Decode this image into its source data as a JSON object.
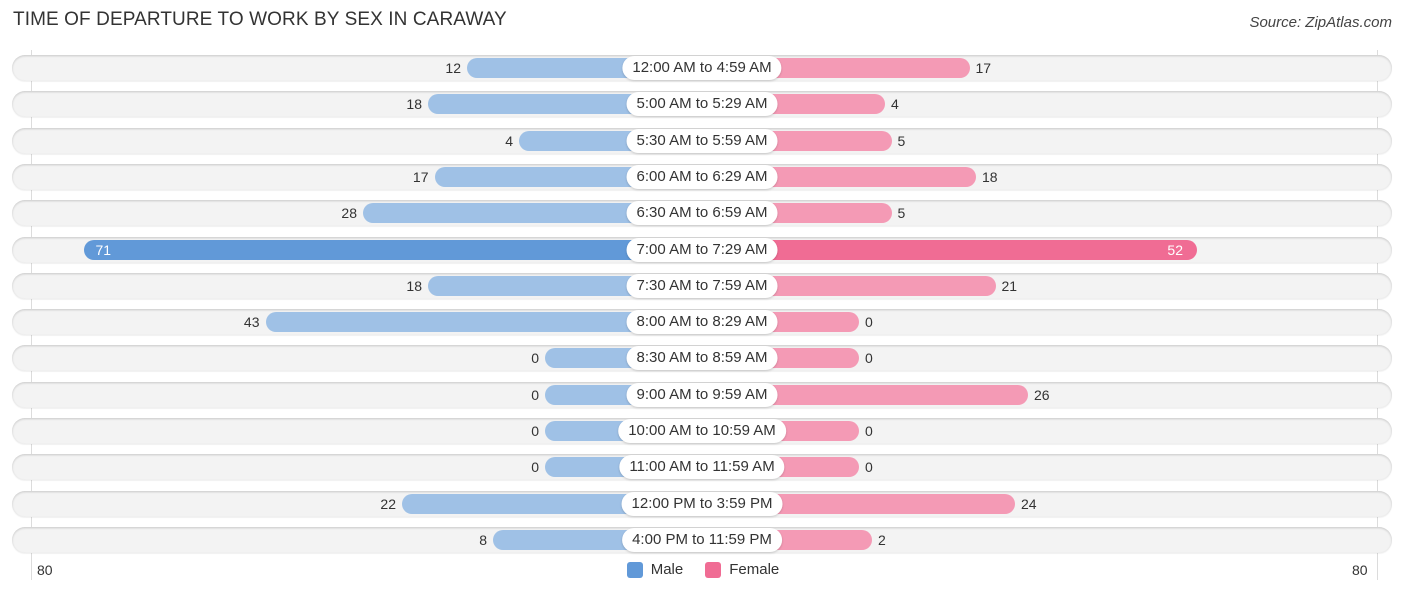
{
  "header": {
    "title": "TIME OF DEPARTURE TO WORK BY SEX IN CARAWAY",
    "source": "Source: ZipAtlas.com"
  },
  "colors": {
    "male": "#9fc1e6",
    "male_highlight": "#6199d8",
    "female": "#f49ab5",
    "female_highlight": "#f06c94"
  },
  "chart_data": {
    "type": "bar",
    "orientation": "horizontal-diverging",
    "title": "TIME OF DEPARTURE TO WORK BY SEX IN CARAWAY",
    "categories": [
      "12:00 AM to 4:59 AM",
      "5:00 AM to 5:29 AM",
      "5:30 AM to 5:59 AM",
      "6:00 AM to 6:29 AM",
      "6:30 AM to 6:59 AM",
      "7:00 AM to 7:29 AM",
      "7:30 AM to 7:59 AM",
      "8:00 AM to 8:29 AM",
      "8:30 AM to 8:59 AM",
      "9:00 AM to 9:59 AM",
      "10:00 AM to 10:59 AM",
      "11:00 AM to 11:59 AM",
      "12:00 PM to 3:59 PM",
      "4:00 PM to 11:59 PM"
    ],
    "series": [
      {
        "name": "Male",
        "values": [
          12,
          18,
          4,
          17,
          28,
          71,
          18,
          43,
          0,
          0,
          0,
          0,
          22,
          8
        ]
      },
      {
        "name": "Female",
        "values": [
          17,
          4,
          5,
          18,
          5,
          52,
          21,
          0,
          0,
          26,
          0,
          0,
          24,
          2
        ]
      }
    ],
    "axis": {
      "left_label": "80",
      "right_label": "80",
      "range": [
        80,
        80
      ]
    },
    "legend": {
      "position": "bottom-center",
      "entries": [
        "Male",
        "Female"
      ]
    },
    "grid": false
  }
}
